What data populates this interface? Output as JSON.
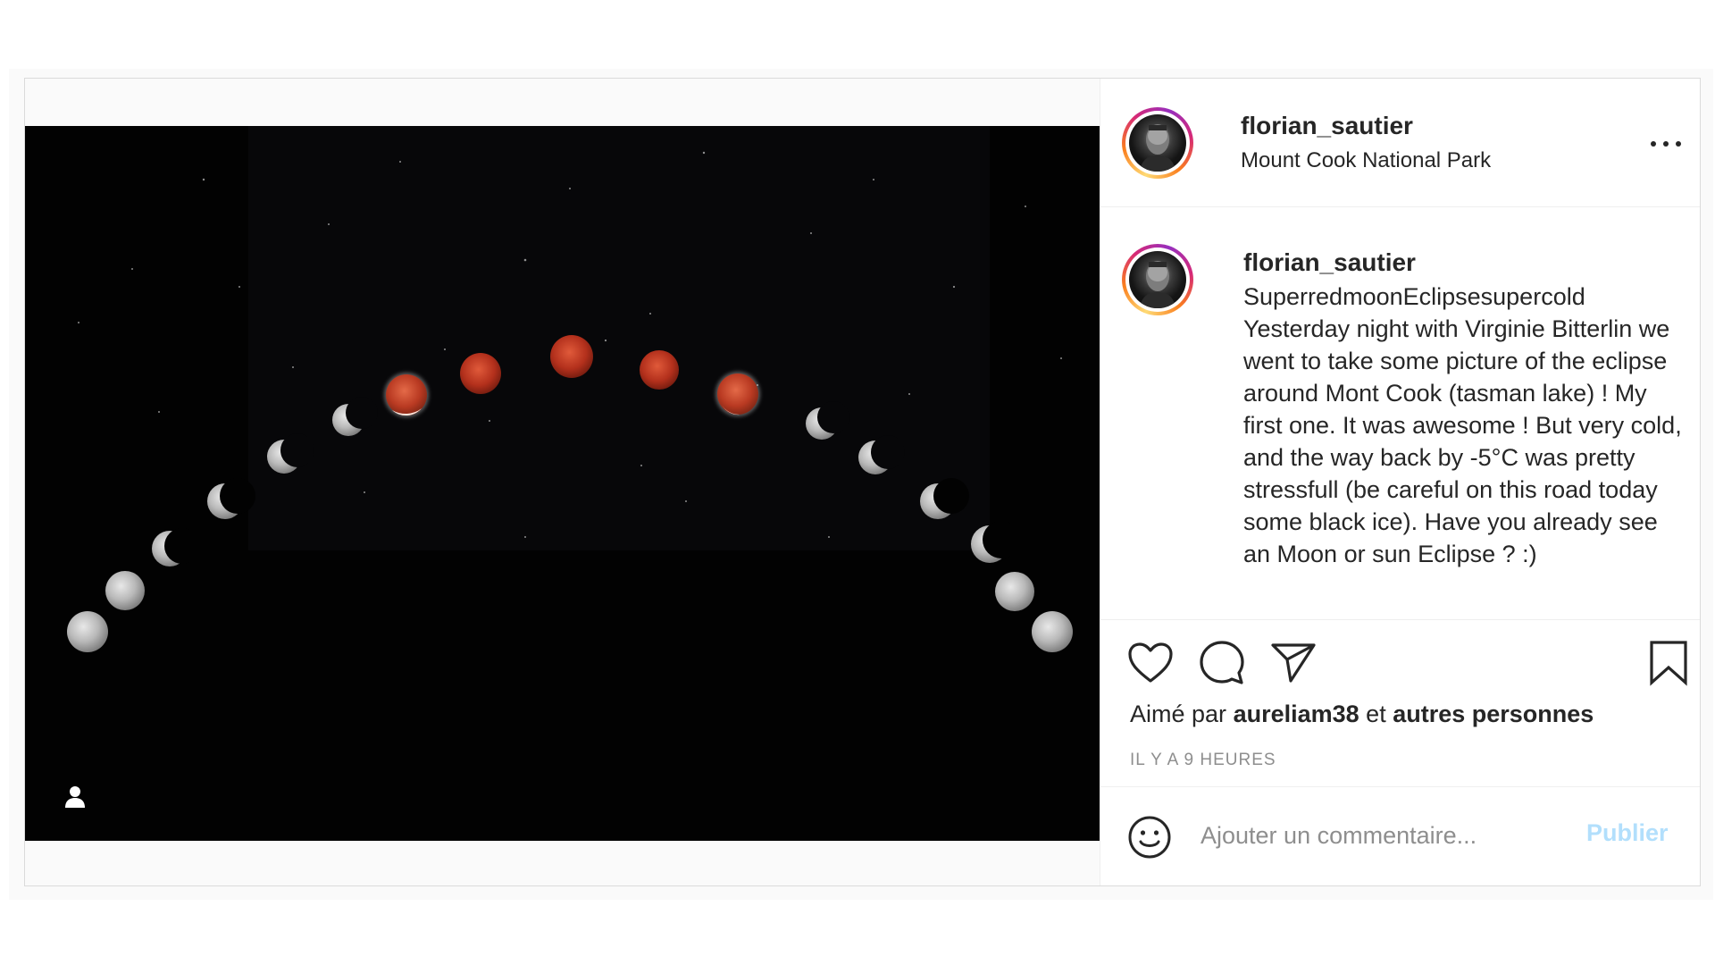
{
  "post": {
    "author": {
      "username": "florian_sautier",
      "location": "Mount Cook National Park"
    },
    "caption": {
      "username": "florian_sautier",
      "text": "SuperredmoonEclipsesupercold\nYesterday night with Virginie Bitterlin we went to take some picture of the eclipse around Mont Cook (tasman lake) ! My first one. It was awesome ! But very cold, and the way back by -5°C was pretty stressfull (be careful on this road today some black ice). Have you already see an Moon or sun Eclipse ? :)"
    },
    "likes": {
      "prefix": "Aimé par",
      "user": "aureliam38",
      "conjunction": "et",
      "others": "autres personnes"
    },
    "timestamp": "IL Y A 9 HEURES",
    "comment": {
      "placeholder": "Ajouter un commentaire...",
      "publish_label": "Publier"
    },
    "icons": {
      "more": "more-options-icon",
      "like": "heart-icon",
      "comment": "comment-bubble-icon",
      "share": "paper-plane-icon",
      "save": "bookmark-icon",
      "emoji": "emoji-icon",
      "tagged_user": "user-tag-icon"
    },
    "colors": {
      "story_ring": [
        "#feda75",
        "#fa7e1e",
        "#d62976",
        "#962fbf"
      ],
      "publish_disabled": "#b2dffc",
      "muted_text": "#8e8e8e",
      "eclipse_red": "#b8321e"
    }
  }
}
